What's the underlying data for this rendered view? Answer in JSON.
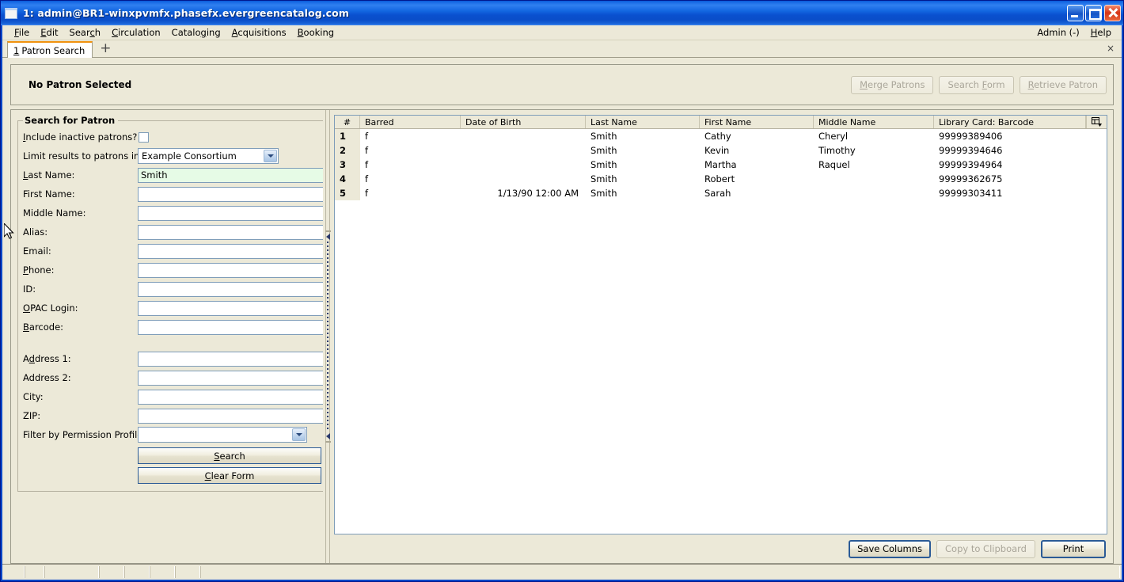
{
  "window": {
    "title": "1: admin@BR1-winxpvmfx.phasefx.evergreencatalog.com",
    "icon": "window-icon",
    "minimize": "minimize-icon",
    "maximize": "maximize-icon",
    "close": "close-icon"
  },
  "menubar": {
    "items": [
      {
        "label": "File",
        "accel": "F"
      },
      {
        "label": "Edit",
        "accel": "E"
      },
      {
        "label": "Search",
        "accel": "c"
      },
      {
        "label": "Circulation",
        "accel": "C"
      },
      {
        "label": "Cataloging",
        "accel": "g"
      },
      {
        "label": "Acquisitions",
        "accel": "A"
      },
      {
        "label": "Booking",
        "accel": "B"
      }
    ],
    "right": [
      {
        "label": "Admin (-)"
      },
      {
        "label": "Help"
      }
    ]
  },
  "tabstrip": {
    "tabs": [
      {
        "number": "1",
        "label": "Patron Search"
      }
    ],
    "new_tab": "+",
    "close_tab": "×"
  },
  "patron_header": {
    "status": "No Patron Selected",
    "buttons": [
      {
        "label": "Merge Patrons",
        "enabled": false
      },
      {
        "label": "Search Form",
        "enabled": false
      },
      {
        "label": "Retrieve Patron",
        "enabled": false
      }
    ]
  },
  "search_form": {
    "legend": "Search for Patron",
    "include_inactive_label": "Include inactive patrons?",
    "include_inactive_checked": false,
    "limit_label": "Limit results to patrons in",
    "limit_value": "Example Consortium",
    "fields": [
      {
        "label": "Last Name:",
        "value": "Smith",
        "focused": true
      },
      {
        "label": "First Name:",
        "value": "",
        "focused": false
      },
      {
        "label": "Middle Name:",
        "value": "",
        "focused": false
      },
      {
        "label": "Alias:",
        "value": "",
        "focused": false
      },
      {
        "label": "Email:",
        "value": "",
        "focused": false
      },
      {
        "label": "Phone:",
        "value": "",
        "focused": false
      },
      {
        "label": "ID:",
        "value": "",
        "focused": false
      },
      {
        "label": "OPAC Login:",
        "value": "",
        "focused": false
      },
      {
        "label": "Barcode:",
        "value": "",
        "focused": false
      }
    ],
    "address_fields": [
      {
        "label": "Address 1:",
        "value": ""
      },
      {
        "label": "Address 2:",
        "value": ""
      },
      {
        "label": "City:",
        "value": ""
      },
      {
        "label": "ZIP:",
        "value": ""
      }
    ],
    "permission_label": "Filter by Permission Profile:",
    "permission_value": "",
    "search_button": "Search",
    "clear_button": "Clear Form"
  },
  "results": {
    "columns": [
      {
        "key": "num",
        "label": "#"
      },
      {
        "key": "barred",
        "label": "Barred"
      },
      {
        "key": "dob",
        "label": "Date of Birth"
      },
      {
        "key": "last",
        "label": "Last Name"
      },
      {
        "key": "first",
        "label": "First Name"
      },
      {
        "key": "middle",
        "label": "Middle Name"
      },
      {
        "key": "barcode",
        "label": "Library Card: Barcode"
      }
    ],
    "column_config_icon": "column-picker-icon",
    "rows": [
      {
        "num": "1",
        "barred": "f",
        "dob": "",
        "last": "Smith",
        "first": "Cathy",
        "middle": "Cheryl",
        "barcode": "99999389406"
      },
      {
        "num": "2",
        "barred": "f",
        "dob": "",
        "last": "Smith",
        "first": "Kevin",
        "middle": "Timothy",
        "barcode": "99999394646"
      },
      {
        "num": "3",
        "barred": "f",
        "dob": "",
        "last": "Smith",
        "first": "Martha",
        "middle": "Raquel",
        "barcode": "99999394964"
      },
      {
        "num": "4",
        "barred": "f",
        "dob": "",
        "last": "Smith",
        "first": "Robert",
        "middle": "",
        "barcode": "99999362675"
      },
      {
        "num": "5",
        "barred": "f",
        "dob": "1/13/90 12:00 AM",
        "last": "Smith",
        "first": "Sarah",
        "middle": "",
        "barcode": "99999303411"
      }
    ],
    "footer_buttons": [
      {
        "label": "Save Columns",
        "enabled": true,
        "default": false
      },
      {
        "label": "Copy to Clipboard",
        "enabled": false,
        "default": false
      },
      {
        "label": "Print",
        "enabled": true,
        "default": true
      }
    ]
  },
  "statusbar": {
    "cells": [
      "",
      "",
      "",
      "",
      "",
      "",
      "",
      ""
    ]
  },
  "colors": {
    "titlebar_blue": "#0a50cf",
    "window_bg": "#ece9d8",
    "tab_accent": "#f0920f",
    "field_focus_green": "#e6fbe6",
    "field_border": "#7f9db9"
  }
}
